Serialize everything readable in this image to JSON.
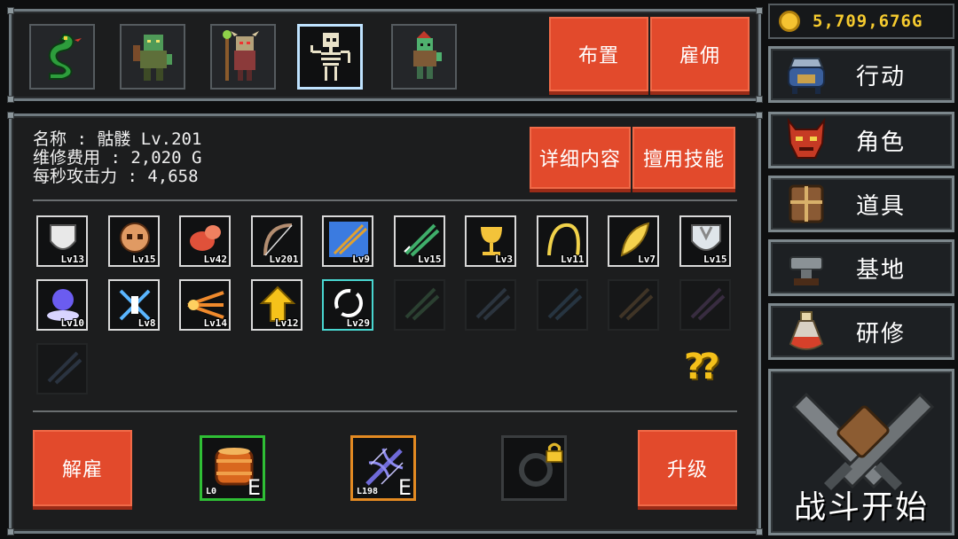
{
  "header": {
    "deploy_label": "布置",
    "hire_label": "雇佣"
  },
  "roster": [
    {
      "name": "green-serpent"
    },
    {
      "name": "orc-brute"
    },
    {
      "name": "goblin-shaman"
    },
    {
      "name": "skeleton",
      "selected": true
    },
    {
      "name": "goblin-archer"
    }
  ],
  "character": {
    "name_line": "名称 : 骷髅 Lv.201",
    "upkeep_line": "维修费用 : 2,020 G",
    "dps_line": "每秒攻击力 : 4,658",
    "details_label": "详细内容",
    "skills_button_label": "擅用技能"
  },
  "skills": [
    {
      "icon": "shield-icon",
      "level": "Lv13",
      "color": "#e8e8e8"
    },
    {
      "icon": "skull-icon",
      "level": "Lv15",
      "color": "#e09a63"
    },
    {
      "icon": "meat-icon",
      "level": "Lv42",
      "color": "#e0513a"
    },
    {
      "icon": "bow-icon",
      "level": "Lv201",
      "color": "#b38d70"
    },
    {
      "icon": "ice-arrows-icon",
      "level": "Lv9",
      "color": "#3b7be0"
    },
    {
      "icon": "poison-arrows-icon",
      "level": "Lv15",
      "color": "#3fae6a"
    },
    {
      "icon": "golden-chalice-icon",
      "level": "Lv3",
      "color": "#f3c33a"
    },
    {
      "icon": "lightning-arc-icon",
      "level": "Lv11",
      "color": "#f1d24a"
    },
    {
      "icon": "golden-feather-icon",
      "level": "Lv7",
      "color": "#f5d24d"
    },
    {
      "icon": "steel-shield-icon",
      "level": "Lv15",
      "color": "#dfe5ea"
    },
    {
      "icon": "spirit-orb-icon",
      "level": "Lv10",
      "color": "#6b5cf0"
    },
    {
      "icon": "crossed-blades-icon",
      "level": "Lv8",
      "color": "#5ab6ff"
    },
    {
      "icon": "fire-claw-icon",
      "level": "Lv14",
      "color": "#f08a2c"
    },
    {
      "icon": "up-arrow-icon",
      "level": "Lv12",
      "color": "#f5c21a"
    },
    {
      "icon": "ring-icon",
      "level": "Lv29",
      "color": "#ffffff"
    },
    {
      "icon": "locked-green-arrows-icon",
      "level": "",
      "color": "#3e6b4a"
    },
    {
      "icon": "locked-crossbow-icon",
      "level": "",
      "color": "#3e5066"
    },
    {
      "icon": "locked-blue-arrows-icon",
      "level": "",
      "color": "#34506b"
    },
    {
      "icon": "locked-club-icon",
      "level": "",
      "color": "#6b5130"
    },
    {
      "icon": "locked-purple-bow-icon",
      "level": "",
      "color": "#5a3f6b"
    },
    {
      "icon": "locked-arrows-icon",
      "level": "",
      "color": "#3b4f6b"
    }
  ],
  "mystery_label": "??",
  "bottom": {
    "dismiss_label": "解雇",
    "upgrade_label": "升级",
    "equip_slots": [
      {
        "icon": "barrel-icon",
        "level": "L0",
        "tag": "E",
        "border": "#2fbf35"
      },
      {
        "icon": "crossbow-icon",
        "level": "L198",
        "tag": "E",
        "border": "#e38a22"
      },
      {
        "icon": "ring-slot-icon",
        "level": "",
        "tag": "",
        "border": "#3a3d3f"
      }
    ]
  },
  "gold": "5,709,676G",
  "menu": [
    {
      "label": "行动",
      "icon": "cauldron-icon"
    },
    {
      "label": "角色",
      "icon": "demon-mask-icon"
    },
    {
      "label": "道具",
      "icon": "chest-icon"
    },
    {
      "label": "基地",
      "icon": "anvil-icon"
    },
    {
      "label": "研修",
      "icon": "potion-icon"
    }
  ],
  "battle_label": "战斗开始",
  "colors": {
    "accent_red": "#e24a2c",
    "gold": "#f6cb2f",
    "panel_border": "#6f7a80"
  }
}
